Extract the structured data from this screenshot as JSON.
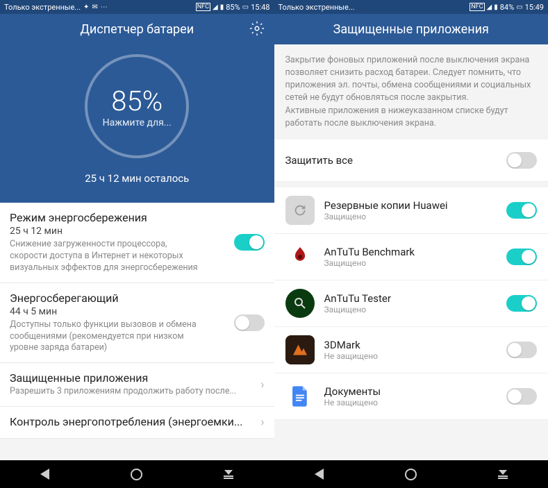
{
  "left": {
    "status": {
      "carrier": "Только экстренные...",
      "nfc": "NFC",
      "battery": "85%",
      "time": "15:48"
    },
    "header": {
      "title": "Диспетчер батареи"
    },
    "hero": {
      "percent": "85%",
      "tap": "Нажмите для...",
      "remaining": "25 ч 12 мин осталось"
    },
    "items": [
      {
        "title": "Режим энергосбережения",
        "time": "25 ч 12 мин",
        "sub": "Снижение загруженности процессора, скорости доступа в Интернет и некоторых визуальных эффектов для энергосбережения",
        "toggle": "on"
      },
      {
        "title": "Энергосберегающий",
        "time": "44 ч 5 мин",
        "sub": "Доступны только функции вызовов и обмена сообщениями (рекомендуется при низком уровне заряда батареи)",
        "toggle": "off"
      },
      {
        "title": "Защищенные приложения",
        "sub": "Разрешить 3 приложениям продолжить работу после...",
        "chev": true
      },
      {
        "title": "Контроль энергопотребления (энергоемки...",
        "chev": true
      }
    ]
  },
  "right": {
    "status": {
      "carrier": "Только экстренные...",
      "nfc": "NFC",
      "battery": "84%",
      "time": "15:49"
    },
    "header": {
      "title": "Защищенные приложения"
    },
    "desc": "Закрытие фоновых приложений после выключения экрана позволяет снизить расход батареи. Следует помнить, что приложения эл. почты, обмена сообщениями и социальных сетей не будут обновляться после закрытия.\nАктивные приложения в нижеуказанном списке будут работать после выключения экрана.",
    "protect_all": {
      "label": "Защитить все",
      "toggle": "off"
    },
    "apps": [
      {
        "name": "Резервные копии Huawei",
        "status": "Защищено",
        "toggle": "on",
        "icon": "backup"
      },
      {
        "name": "AnTuTu Benchmark",
        "status": "Защищено",
        "toggle": "on",
        "icon": "antutu"
      },
      {
        "name": "AnTuTu Tester",
        "status": "Защищено",
        "toggle": "on",
        "icon": "tester"
      },
      {
        "name": "3DMark",
        "status": "Не защищено",
        "toggle": "off",
        "icon": "3dmark"
      },
      {
        "name": "Документы",
        "status": "Не защищено",
        "toggle": "off",
        "icon": "docs"
      }
    ]
  }
}
